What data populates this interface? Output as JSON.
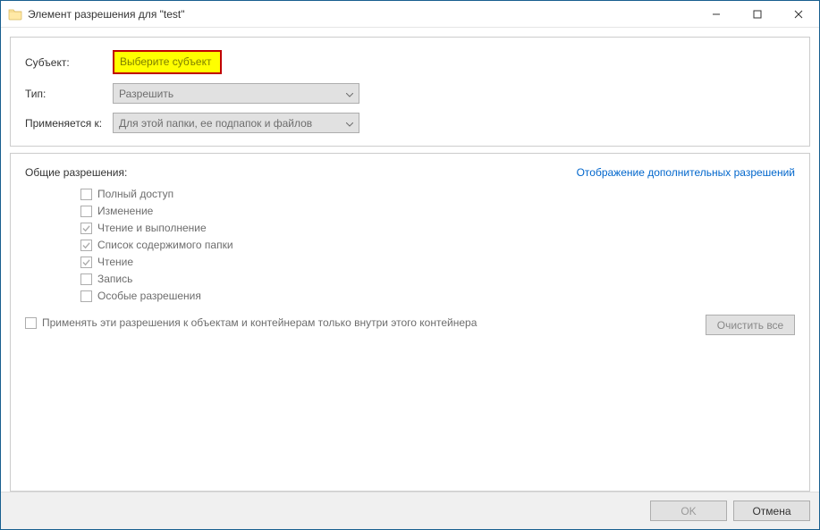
{
  "window": {
    "title": "Элемент разрешения для \"test\""
  },
  "form": {
    "subject_label": "Субъект:",
    "select_subject_link": "Выберите субъект",
    "type_label": "Тип:",
    "type_value": "Разрешить",
    "applies_label": "Применяется к:",
    "applies_value": "Для этой папки, ее подпапок и файлов"
  },
  "permissions": {
    "title": "Общие разрешения:",
    "advanced_link": "Отображение дополнительных разрешений",
    "items": [
      {
        "label": "Полный доступ",
        "checked": false
      },
      {
        "label": "Изменение",
        "checked": false
      },
      {
        "label": "Чтение и выполнение",
        "checked": true
      },
      {
        "label": "Список содержимого папки",
        "checked": true
      },
      {
        "label": "Чтение",
        "checked": true
      },
      {
        "label": "Запись",
        "checked": false
      },
      {
        "label": "Особые разрешения",
        "checked": false
      }
    ],
    "apply_only_label": "Применять эти разрешения к объектам и контейнерам только внутри этого контейнера",
    "clear_all": "Очистить все"
  },
  "footer": {
    "ok": "OK",
    "cancel": "Отмена"
  }
}
